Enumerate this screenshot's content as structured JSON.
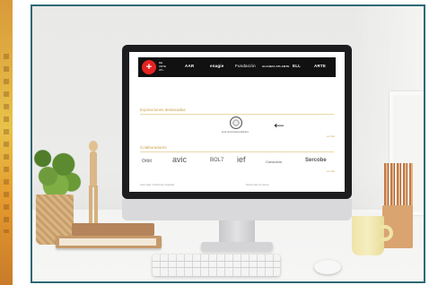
{
  "colors": {
    "frame_border": "#2d6a73",
    "site_header_bg": "#111111",
    "logo_red": "#e52421",
    "accent_gold": "#c9a24a"
  },
  "website": {
    "logo": {
      "mark": "+",
      "text": "DE ARTE ATL"
    },
    "partners": [
      "AAR",
      "enagie",
      "Fundación",
      "ALIANZA ATLANTE",
      "ELL",
      "ARTE"
    ],
    "section1_title": "Exposiciones destacadas",
    "seal_caption": "Aula Universitaria Atlantica",
    "section1_link": "ver más",
    "section2_title": "Colaboradores",
    "collaborators": [
      "Orbit",
      "avic",
      "BOL7",
      "ief",
      "Consorcio",
      "Sercobe"
    ],
    "section2_link": "ver más",
    "footer_left": "Aviso legal - Política de privacidad",
    "footer_right": "Diseño web por Ateneo"
  },
  "annotation": {
    "arrow_glyph": "←"
  }
}
